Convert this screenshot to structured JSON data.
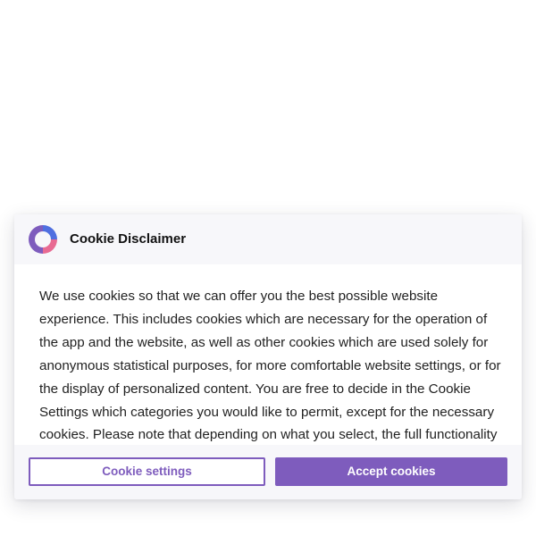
{
  "cookie_banner": {
    "logo_icon": "donut-logo-icon",
    "title": "Cookie Disclaimer",
    "body_text": "We use cookies so that we can offer you the best possible website experience. This includes cookies which are necessary for the operation of the app and the website, as well as other cookies which are used solely for anonymous statistical purposes, for more comfortable website settings, or for the display of personalized content. You are free to decide in the Cookie Settings which categories you would like to permit, except for the necessary cookies. Please note that depending on what you select, the full functionality",
    "settings_button_label": "Cookie settings",
    "accept_button_label": "Accept cookies"
  },
  "colors": {
    "accent": "#7e5cbd",
    "logo_blue": "#4f6fe0",
    "logo_purple": "#7e5cbd",
    "logo_pink": "#e86a92",
    "header_background": "#f7f7fa"
  }
}
